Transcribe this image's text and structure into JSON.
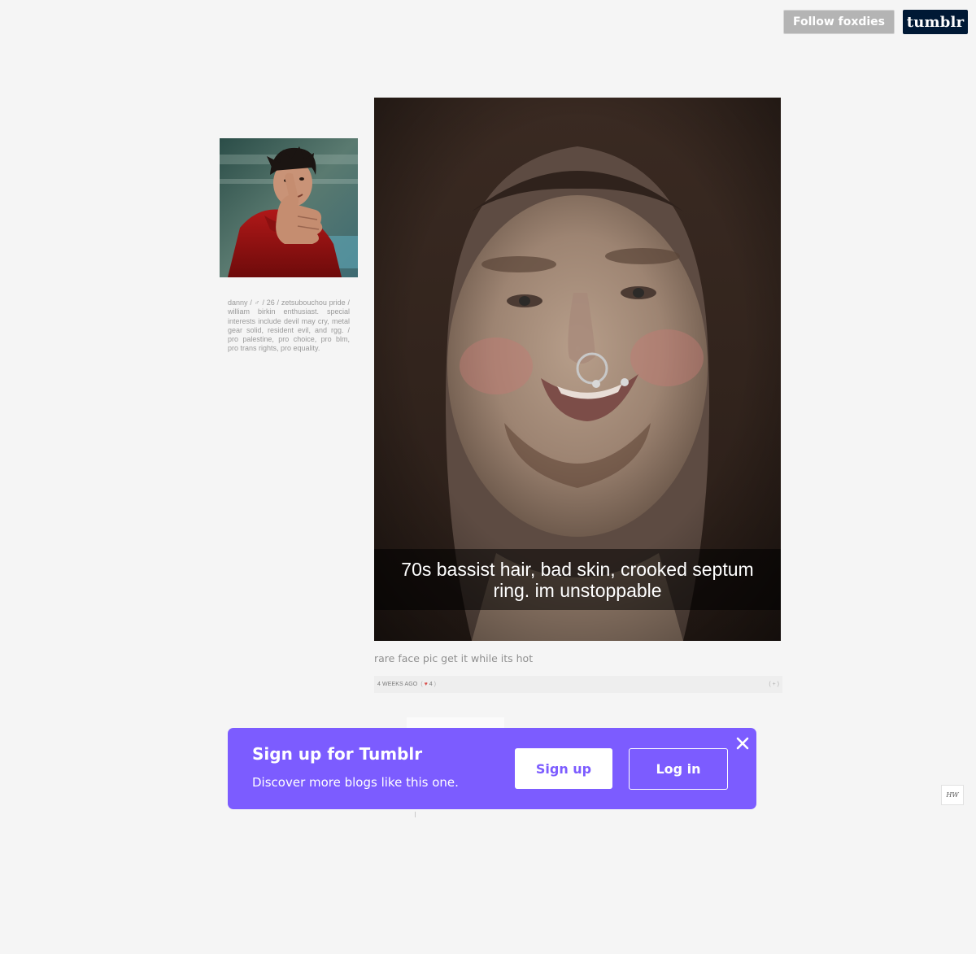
{
  "header": {
    "follow_label": "Follow foxdies",
    "logo_text": "tumblr"
  },
  "sidebar": {
    "bio": "danny / ♂ / 26 / zetsubouchou pride / william birkin enthusiast. special interests include devil may cry, metal gear solid, resident evil, and rgg. / pro palestine, pro choice, pro blm, pro trans rights, pro equality."
  },
  "post": {
    "photo_caption": "70s bassist hair, bad skin, crooked septum ring. im unstoppable",
    "caption": "rare face pic get it while its hot",
    "date": "4 WEEKS AGO",
    "notes_open": "(",
    "notes_heart": "♥",
    "notes_count": "4",
    "notes_close": ")",
    "reblog": "( + )"
  },
  "signup_banner": {
    "title": "Sign up for Tumblr",
    "subtitle": "Discover more blogs like this one.",
    "signup_label": "Sign up",
    "login_label": "Log in"
  },
  "badge": {
    "text": "HW"
  },
  "colors": {
    "background": "#f5f5f5",
    "banner": "#7c5cff",
    "logo_bg": "#001935",
    "follow_bg": "#b4b4b4"
  }
}
